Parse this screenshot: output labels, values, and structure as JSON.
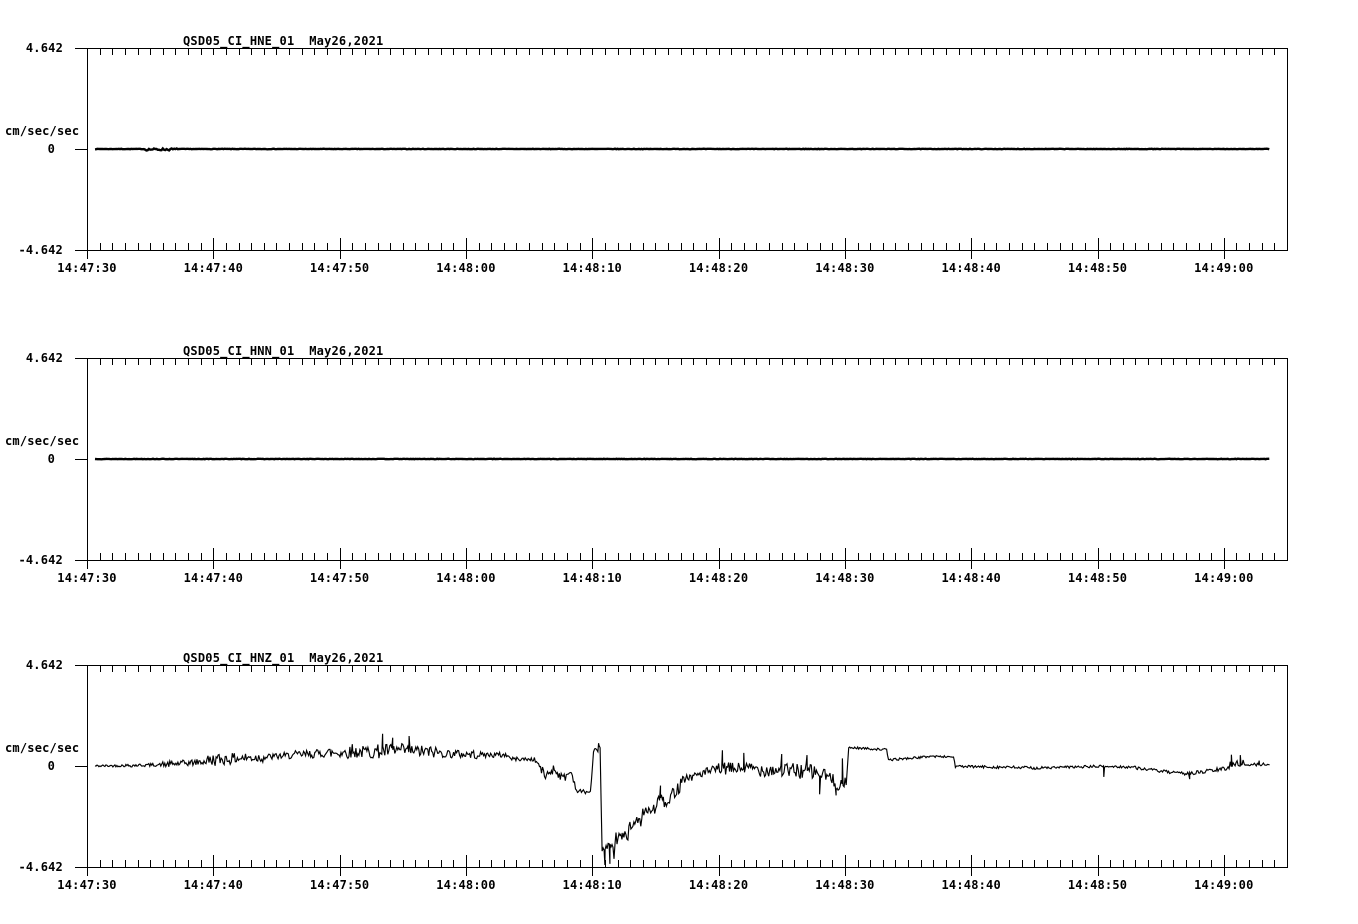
{
  "page": {
    "background_color": "#ffffff",
    "trace_color": "#000000",
    "description": "Three-channel strong-motion seismogram display for station QSD05 (network CI), May 26 2021, 14:47:30 - 14:49:05"
  },
  "chart_data": [
    {
      "type": "line",
      "title": "QSD05_CI_HNE_01  May26,2021",
      "station_channel": "QSD05_CI_HNE_01",
      "date": "May26,2021",
      "ylabel": "cm/sec/sec",
      "y_max_label": "4.642",
      "y_zero_label": "0",
      "y_min_label": "-4.642",
      "ylim": [
        -4.642,
        4.642
      ],
      "x_total_seconds": 95,
      "x_tick_seconds": [
        0,
        10,
        20,
        30,
        40,
        50,
        60,
        70,
        80,
        90
      ],
      "x_tick_labels": [
        "14:47:30",
        "14:47:40",
        "14:47:50",
        "14:48:00",
        "14:48:10",
        "14:48:20",
        "14:48:30",
        "14:48:40",
        "14:48:50",
        "14:49:00"
      ],
      "grid": false,
      "legend": "none",
      "trace": {
        "summary": "flat line at zero - no significant motion, faint speckle near 14:47:35",
        "seed": 7,
        "dt": 0.1,
        "stroke_width": 2.4,
        "segments": [
          [
            0.63,
            4.6,
            0,
            0,
            0.012
          ],
          [
            4.6,
            7.2,
            -0.02,
            -0.02,
            0.05
          ],
          [
            7.2,
            93.7,
            0,
            0,
            0.012
          ]
        ],
        "spikes": []
      }
    },
    {
      "type": "line",
      "title": "QSD05_CI_HNN_01  May26,2021",
      "station_channel": "QSD05_CI_HNN_01",
      "date": "May26,2021",
      "ylabel": "cm/sec/sec",
      "y_max_label": "4.642",
      "y_zero_label": "0",
      "y_min_label": "-4.642",
      "ylim": [
        -4.642,
        4.642
      ],
      "x_total_seconds": 95,
      "x_tick_seconds": [
        0,
        10,
        20,
        30,
        40,
        50,
        60,
        70,
        80,
        90
      ],
      "x_tick_labels": [
        "14:47:30",
        "14:47:40",
        "14:47:50",
        "14:48:00",
        "14:48:10",
        "14:48:20",
        "14:48:30",
        "14:48:40",
        "14:48:50",
        "14:49:00"
      ],
      "grid": false,
      "legend": "none",
      "trace": {
        "summary": "flat line at zero - no significant motion",
        "seed": 13,
        "dt": 0.1,
        "stroke_width": 2.4,
        "segments": [
          [
            0.63,
            93.7,
            0,
            0,
            0.012
          ]
        ],
        "spikes": []
      }
    },
    {
      "type": "line",
      "title": "QSD05_CI_HNZ_01  May26,2021",
      "station_channel": "QSD05_CI_HNZ_01",
      "date": "May26,2021",
      "ylabel": "cm/sec/sec",
      "y_max_label": "4.642",
      "y_zero_label": "0",
      "y_min_label": "-4.642",
      "ylim": [
        -4.642,
        4.642
      ],
      "x_total_seconds": 95,
      "x_tick_seconds": [
        0,
        10,
        20,
        30,
        40,
        50,
        60,
        70,
        80,
        90
      ],
      "x_tick_labels": [
        "14:47:30",
        "14:47:40",
        "14:47:50",
        "14:48:00",
        "14:48:10",
        "14:48:20",
        "14:48:30",
        "14:48:40",
        "14:48:50",
        "14:49:00"
      ],
      "grid": false,
      "legend": "none",
      "trace": {
        "summary": "noisy vertical-channel trace: slow positive hump to ~+0.9 peaking near 14:47:52, step-downs and dips to -1.2 before a large negative spike to ~-4.5 just after 14:48:10, staircase recovery, noisy section around -0.2 until 14:48:30, step plateaus +0.85 / +0.4 / ~0, gentle dip to -0.35 near 14:48:56, returning to ~0 by 14:49:03",
        "seed": 42,
        "dt": 0.08,
        "stroke_width": 1.15,
        "segments": [
          [
            0.63,
            3.0,
            0.0,
            0.02,
            0.055
          ],
          [
            3.0,
            6.0,
            0.02,
            0.06,
            0.075
          ],
          [
            6.0,
            9.5,
            0.06,
            0.2,
            0.15
          ],
          [
            9.5,
            11.5,
            0.25,
            0.35,
            0.28
          ],
          [
            11.5,
            14.0,
            0.35,
            0.4,
            0.24
          ],
          [
            14.0,
            16.5,
            0.4,
            0.5,
            0.16
          ],
          [
            16.5,
            19.0,
            0.5,
            0.6,
            0.2
          ],
          [
            19.0,
            22.0,
            0.6,
            0.65,
            0.28
          ],
          [
            22.0,
            25.0,
            0.65,
            0.72,
            0.33
          ],
          [
            25.0,
            28.0,
            0.72,
            0.62,
            0.28
          ],
          [
            28.0,
            31.0,
            0.58,
            0.52,
            0.2
          ],
          [
            31.0,
            33.3,
            0.52,
            0.5,
            0.13
          ],
          [
            33.3,
            33.55,
            0.5,
            0.33,
            0.04
          ],
          [
            33.55,
            35.5,
            0.33,
            0.3,
            0.09
          ],
          [
            35.5,
            36.3,
            0.3,
            -0.5,
            0.22
          ],
          [
            36.3,
            37.0,
            -0.45,
            -0.1,
            0.22
          ],
          [
            37.0,
            37.7,
            -0.15,
            -0.6,
            0.2
          ],
          [
            37.7,
            38.35,
            -0.55,
            -0.25,
            0.22
          ],
          [
            38.35,
            38.75,
            -0.3,
            -1.1,
            0.12
          ],
          [
            38.75,
            39.85,
            -1.15,
            -1.2,
            0.1
          ],
          [
            39.85,
            40.1,
            -1.2,
            0.55,
            0.08
          ],
          [
            40.1,
            40.62,
            0.62,
            0.88,
            0.14
          ],
          [
            40.62,
            40.78,
            0.88,
            -4.1,
            0.05
          ],
          [
            40.78,
            41.8,
            -3.9,
            -4.0,
            0.4
          ],
          [
            41.8,
            42.9,
            -3.35,
            -3.2,
            0.28
          ],
          [
            42.9,
            44.0,
            -2.7,
            -2.5,
            0.25
          ],
          [
            44.0,
            45.1,
            -2.15,
            -2.0,
            0.25
          ],
          [
            45.1,
            45.7,
            -1.6,
            -1.45,
            0.28
          ],
          [
            45.7,
            46.2,
            -1.8,
            -1.7,
            0.13
          ],
          [
            46.2,
            47.0,
            -1.35,
            -0.9,
            0.28
          ],
          [
            47.0,
            48.2,
            -0.6,
            -0.45,
            0.2
          ],
          [
            48.2,
            50.0,
            -0.4,
            -0.15,
            0.22
          ],
          [
            50.0,
            53.0,
            -0.12,
            -0.1,
            0.28
          ],
          [
            53.0,
            55.5,
            -0.15,
            -0.2,
            0.33
          ],
          [
            55.5,
            57.5,
            -0.2,
            -0.25,
            0.38
          ],
          [
            57.5,
            58.9,
            -0.3,
            -0.5,
            0.35
          ],
          [
            58.9,
            60.1,
            -0.7,
            -0.9,
            0.35
          ],
          [
            60.1,
            60.3,
            -0.9,
            0.8,
            0.06
          ],
          [
            60.3,
            63.3,
            0.85,
            0.75,
            0.05
          ],
          [
            63.3,
            63.45,
            0.75,
            0.28,
            0.03
          ],
          [
            63.45,
            66.5,
            0.28,
            0.42,
            0.05
          ],
          [
            66.5,
            68.6,
            0.45,
            0.42,
            0.05
          ],
          [
            68.6,
            68.75,
            0.42,
            -0.02,
            0.03
          ],
          [
            68.75,
            72.0,
            -0.02,
            -0.05,
            0.06
          ],
          [
            72.0,
            76.0,
            -0.05,
            -0.1,
            0.07
          ],
          [
            76.0,
            80.0,
            -0.08,
            -0.02,
            0.06
          ],
          [
            80.0,
            83.0,
            -0.02,
            -0.05,
            0.06
          ],
          [
            83.0,
            86.5,
            -0.08,
            -0.35,
            0.07
          ],
          [
            86.5,
            88.5,
            -0.35,
            -0.28,
            0.09
          ],
          [
            88.5,
            90.5,
            -0.25,
            -0.1,
            0.1
          ],
          [
            90.5,
            91.6,
            0.1,
            0.15,
            0.15
          ],
          [
            91.6,
            93.7,
            0.05,
            0.08,
            0.07
          ]
        ],
        "spikes": [
          [
            21.0,
            1.0
          ],
          [
            23.4,
            1.48
          ],
          [
            24.2,
            1.3
          ],
          [
            25.5,
            1.38
          ],
          [
            40.5,
            1.05
          ],
          [
            41.0,
            -4.55
          ],
          [
            41.4,
            -4.5
          ],
          [
            45.4,
            -0.9
          ],
          [
            50.3,
            0.72
          ],
          [
            52.0,
            0.6
          ],
          [
            55.0,
            0.55
          ],
          [
            57.0,
            0.5
          ],
          [
            58.0,
            -1.3
          ],
          [
            59.3,
            -1.35
          ],
          [
            59.8,
            0.35
          ],
          [
            80.5,
            -0.5
          ],
          [
            87.3,
            -0.6
          ],
          [
            90.6,
            0.52
          ],
          [
            91.3,
            0.5
          ],
          [
            92.8,
            0.25
          ]
        ]
      }
    }
  ]
}
